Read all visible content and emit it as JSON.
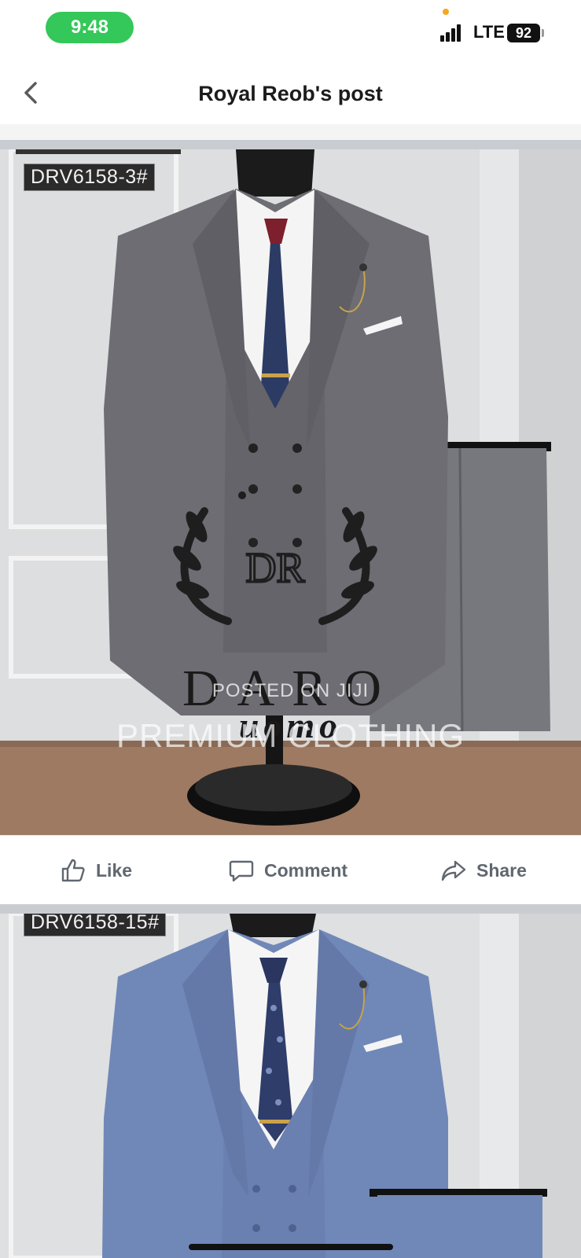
{
  "status_bar": {
    "time": "9:48",
    "network": "LTE",
    "battery": "92"
  },
  "nav": {
    "title": "Royal Reob's post"
  },
  "post1": {
    "code": "DRV6158-3#",
    "brand": "DARO",
    "brand_sub": "uomo",
    "watermark_top": "POSTED ON JIJI",
    "watermark_bottom": "PREMIUM CLOTHING"
  },
  "actions": {
    "like": "Like",
    "comment": "Comment",
    "share": "Share"
  },
  "post2": {
    "code": "DRV6158-15#"
  },
  "colors": {
    "accent_green": "#34c759",
    "suit_grey": "#6e6e74",
    "suit_blue": "#6f86b5"
  },
  "icons": [
    "back-chevron-icon",
    "signal-icon",
    "battery-icon",
    "like-thumb-icon",
    "comment-bubble-icon",
    "share-arrow-icon"
  ]
}
